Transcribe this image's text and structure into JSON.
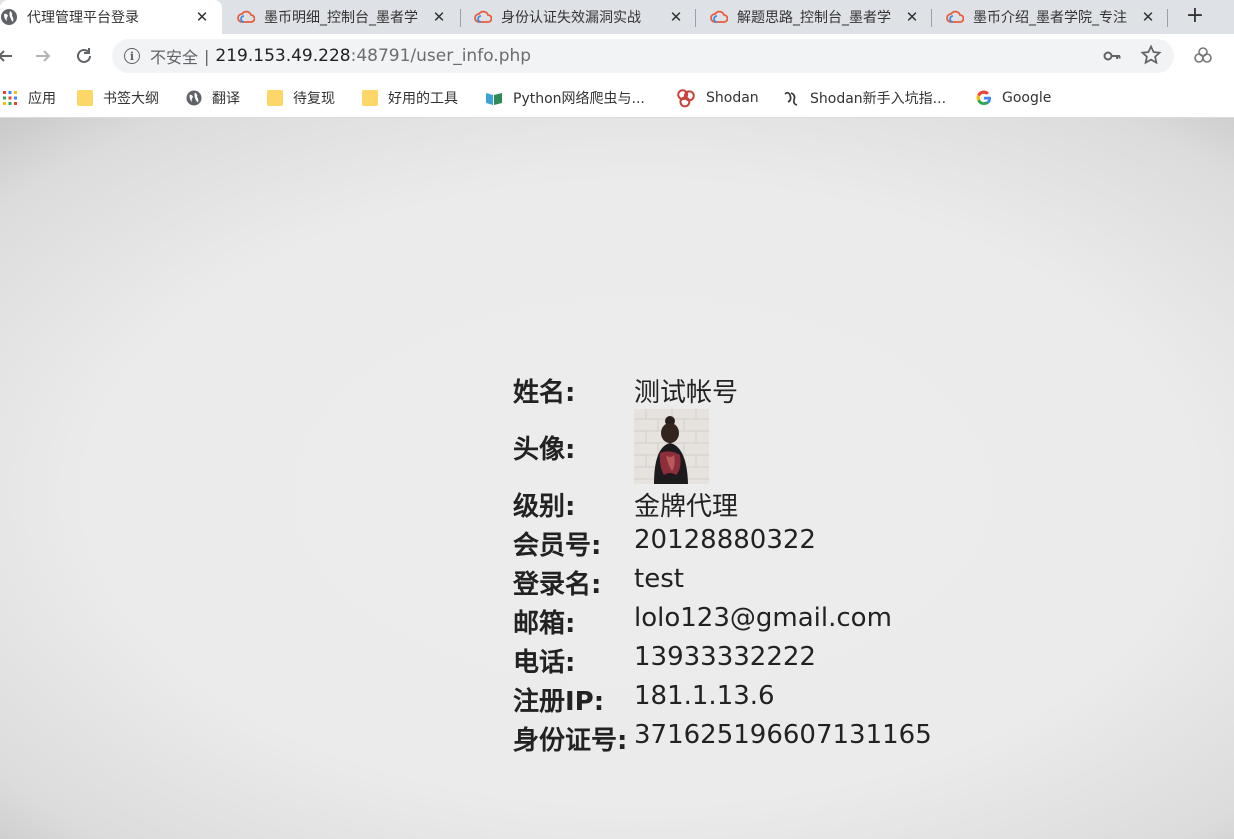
{
  "tabs": [
    {
      "title": "代理管理平台登录",
      "icon": "globe-icon",
      "active": true
    },
    {
      "title": "墨币明细_控制台_墨者学",
      "icon": "cloud-icon",
      "active": false
    },
    {
      "title": "身份认证失效漏洞实战",
      "icon": "cloud-icon",
      "active": false
    },
    {
      "title": "解题思路_控制台_墨者学",
      "icon": "cloud-icon",
      "active": false
    },
    {
      "title": "墨币介绍_墨者学院_专注",
      "icon": "cloud-icon",
      "active": false
    }
  ],
  "toolbar": {
    "security_label": "不安全",
    "separator": "|",
    "url_host": "219.153.49.228",
    "url_rest": ":48791/user_info.php"
  },
  "bookmarks": [
    {
      "label": "应用",
      "icon": "apps-grid-icon"
    },
    {
      "label": "书签大纲",
      "icon": "folder-icon"
    },
    {
      "label": "翻译",
      "icon": "globe-icon"
    },
    {
      "label": "待复现",
      "icon": "folder-icon"
    },
    {
      "label": "好用的工具",
      "icon": "folder-icon"
    },
    {
      "label": "Python网络爬虫与...",
      "icon": "book-icon"
    },
    {
      "label": "Shodan",
      "icon": "shodan-icon"
    },
    {
      "label": "Shodan新手入坑指...",
      "icon": "shodan-alt-icon"
    },
    {
      "label": "Google",
      "icon": "google-icon"
    }
  ],
  "user_info": {
    "name_label": "姓名:",
    "name_value": "测试帐号",
    "avatar_label": "头像:",
    "level_label": "级别:",
    "level_value": "金牌代理",
    "member_label": "会员号:",
    "member_value": "20128880322",
    "login_label": "登录名:",
    "login_value": "test",
    "email_label": "邮箱:",
    "email_value": "lolo123@gmail.com",
    "phone_label": "电话:",
    "phone_value": "13933332222",
    "ip_label": "注册IP:",
    "ip_value": "181.1.13.6",
    "id_label": "身份证号:",
    "id_value": "371625196607131165"
  }
}
